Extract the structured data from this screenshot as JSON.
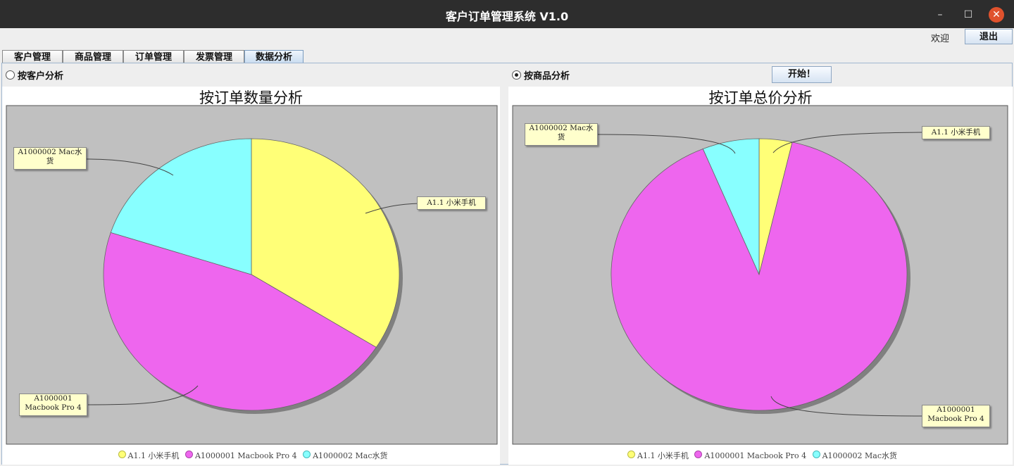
{
  "window": {
    "title": "客户订单管理系统 V1.0",
    "minimize_label": "–",
    "maximize_label": "☐",
    "close_label": "✕"
  },
  "header": {
    "welcome": "欢迎",
    "exit_label": "退出"
  },
  "tabs": [
    "客户管理",
    "商品管理",
    "订单管理",
    "发票管理",
    "数据分析"
  ],
  "active_tab": "数据分析",
  "controls": {
    "by_customer": "按客户分析",
    "by_product": "按商品分析",
    "selected": "按商品分析",
    "start_label": "开始！"
  },
  "colors": {
    "yellow": "#ffff77",
    "magenta": "#ee66ee",
    "cyan": "#88ffff",
    "plot_bg": "#c0c0c0"
  },
  "legend": [
    "A1.1 小米手机",
    "A1000001 Macbook Pro 4",
    "A1000002 Mac水货"
  ],
  "chart_labels": {
    "xiaomi": "A1.1 小米手机",
    "macbook_1": "A1000001",
    "macbook_2": "Macbook Pro 4",
    "macwater_1": "A1000002 Mac水",
    "macwater_2": "货"
  },
  "chart_data": [
    {
      "type": "pie",
      "title": "按订单数量分析",
      "categories": [
        "A1.1 小米手机",
        "A1000001 Macbook Pro 4",
        "A1000002 Mac水货"
      ],
      "values": [
        34,
        46,
        20
      ]
    },
    {
      "type": "pie",
      "title": "按订单总价分析",
      "categories": [
        "A1.1 小米手机",
        "A1000001 Macbook Pro 4",
        "A1000002 Mac水货"
      ],
      "values": [
        3.6,
        90.2,
        6.2
      ]
    }
  ]
}
